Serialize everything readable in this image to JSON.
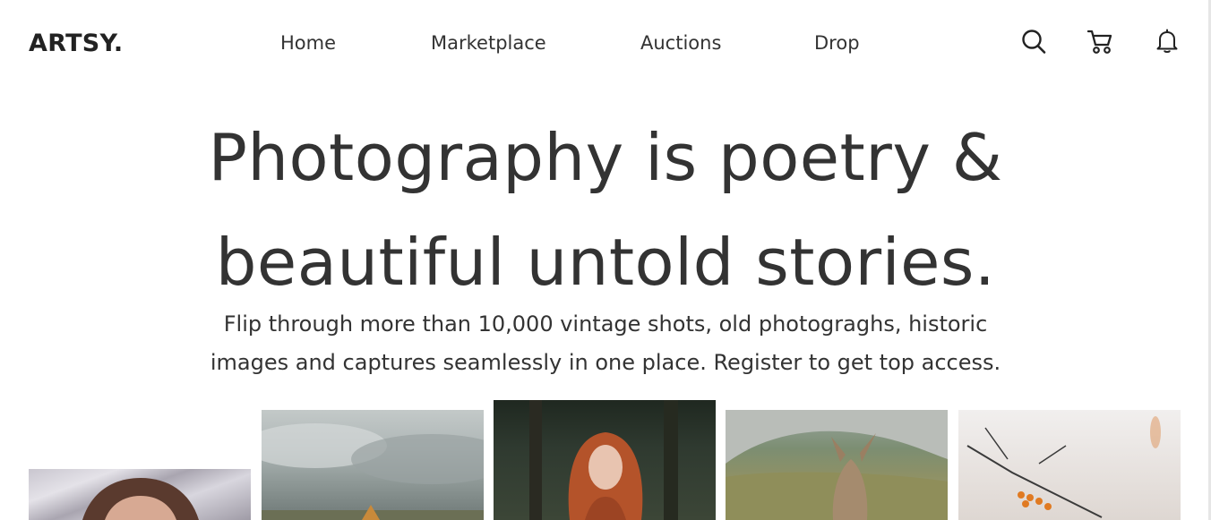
{
  "header": {
    "logo": "ARTSY.",
    "nav": [
      {
        "label": "Home"
      },
      {
        "label": "Marketplace"
      },
      {
        "label": "Auctions"
      },
      {
        "label": "Drop"
      }
    ],
    "icons": [
      "search-icon",
      "cart-icon",
      "bell-icon"
    ]
  },
  "hero": {
    "title_line1": "Photography is poetry &",
    "title_line2": "beautiful untold stories.",
    "subtitle_line1": "Flip through more than 10,000 vintage shots, old photograghs, historic",
    "subtitle_line2": "images and captures seamlessly in one place. Register to get top access."
  },
  "gallery": {
    "photos": [
      {
        "subject": "girl-on-foil"
      },
      {
        "subject": "cloudy-sky-landscape"
      },
      {
        "subject": "red-haired-girl-forest"
      },
      {
        "subject": "kangaroo-field"
      },
      {
        "subject": "berry-branch"
      }
    ]
  },
  "colors": {
    "text": "#333333",
    "background": "#ffffff"
  }
}
